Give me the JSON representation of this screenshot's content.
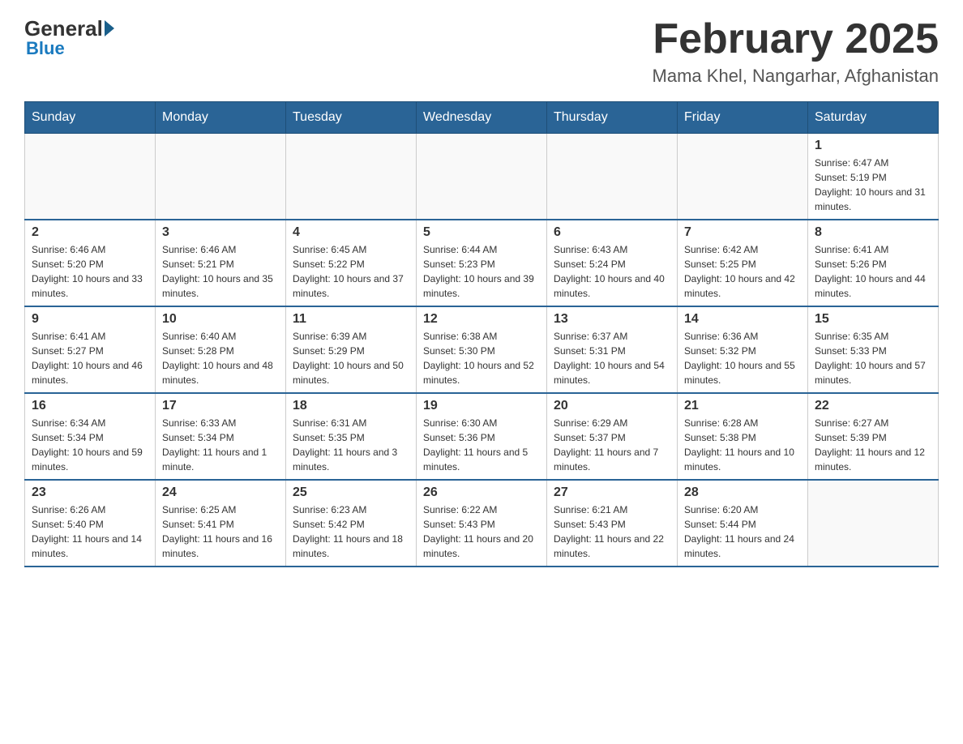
{
  "header": {
    "logo_general": "General",
    "logo_blue": "Blue",
    "month_title": "February 2025",
    "location": "Mama Khel, Nangarhar, Afghanistan"
  },
  "weekdays": [
    "Sunday",
    "Monday",
    "Tuesday",
    "Wednesday",
    "Thursday",
    "Friday",
    "Saturday"
  ],
  "weeks": [
    [
      {
        "day": "",
        "info": ""
      },
      {
        "day": "",
        "info": ""
      },
      {
        "day": "",
        "info": ""
      },
      {
        "day": "",
        "info": ""
      },
      {
        "day": "",
        "info": ""
      },
      {
        "day": "",
        "info": ""
      },
      {
        "day": "1",
        "info": "Sunrise: 6:47 AM\nSunset: 5:19 PM\nDaylight: 10 hours and 31 minutes."
      }
    ],
    [
      {
        "day": "2",
        "info": "Sunrise: 6:46 AM\nSunset: 5:20 PM\nDaylight: 10 hours and 33 minutes."
      },
      {
        "day": "3",
        "info": "Sunrise: 6:46 AM\nSunset: 5:21 PM\nDaylight: 10 hours and 35 minutes."
      },
      {
        "day": "4",
        "info": "Sunrise: 6:45 AM\nSunset: 5:22 PM\nDaylight: 10 hours and 37 minutes."
      },
      {
        "day": "5",
        "info": "Sunrise: 6:44 AM\nSunset: 5:23 PM\nDaylight: 10 hours and 39 minutes."
      },
      {
        "day": "6",
        "info": "Sunrise: 6:43 AM\nSunset: 5:24 PM\nDaylight: 10 hours and 40 minutes."
      },
      {
        "day": "7",
        "info": "Sunrise: 6:42 AM\nSunset: 5:25 PM\nDaylight: 10 hours and 42 minutes."
      },
      {
        "day": "8",
        "info": "Sunrise: 6:41 AM\nSunset: 5:26 PM\nDaylight: 10 hours and 44 minutes."
      }
    ],
    [
      {
        "day": "9",
        "info": "Sunrise: 6:41 AM\nSunset: 5:27 PM\nDaylight: 10 hours and 46 minutes."
      },
      {
        "day": "10",
        "info": "Sunrise: 6:40 AM\nSunset: 5:28 PM\nDaylight: 10 hours and 48 minutes."
      },
      {
        "day": "11",
        "info": "Sunrise: 6:39 AM\nSunset: 5:29 PM\nDaylight: 10 hours and 50 minutes."
      },
      {
        "day": "12",
        "info": "Sunrise: 6:38 AM\nSunset: 5:30 PM\nDaylight: 10 hours and 52 minutes."
      },
      {
        "day": "13",
        "info": "Sunrise: 6:37 AM\nSunset: 5:31 PM\nDaylight: 10 hours and 54 minutes."
      },
      {
        "day": "14",
        "info": "Sunrise: 6:36 AM\nSunset: 5:32 PM\nDaylight: 10 hours and 55 minutes."
      },
      {
        "day": "15",
        "info": "Sunrise: 6:35 AM\nSunset: 5:33 PM\nDaylight: 10 hours and 57 minutes."
      }
    ],
    [
      {
        "day": "16",
        "info": "Sunrise: 6:34 AM\nSunset: 5:34 PM\nDaylight: 10 hours and 59 minutes."
      },
      {
        "day": "17",
        "info": "Sunrise: 6:33 AM\nSunset: 5:34 PM\nDaylight: 11 hours and 1 minute."
      },
      {
        "day": "18",
        "info": "Sunrise: 6:31 AM\nSunset: 5:35 PM\nDaylight: 11 hours and 3 minutes."
      },
      {
        "day": "19",
        "info": "Sunrise: 6:30 AM\nSunset: 5:36 PM\nDaylight: 11 hours and 5 minutes."
      },
      {
        "day": "20",
        "info": "Sunrise: 6:29 AM\nSunset: 5:37 PM\nDaylight: 11 hours and 7 minutes."
      },
      {
        "day": "21",
        "info": "Sunrise: 6:28 AM\nSunset: 5:38 PM\nDaylight: 11 hours and 10 minutes."
      },
      {
        "day": "22",
        "info": "Sunrise: 6:27 AM\nSunset: 5:39 PM\nDaylight: 11 hours and 12 minutes."
      }
    ],
    [
      {
        "day": "23",
        "info": "Sunrise: 6:26 AM\nSunset: 5:40 PM\nDaylight: 11 hours and 14 minutes."
      },
      {
        "day": "24",
        "info": "Sunrise: 6:25 AM\nSunset: 5:41 PM\nDaylight: 11 hours and 16 minutes."
      },
      {
        "day": "25",
        "info": "Sunrise: 6:23 AM\nSunset: 5:42 PM\nDaylight: 11 hours and 18 minutes."
      },
      {
        "day": "26",
        "info": "Sunrise: 6:22 AM\nSunset: 5:43 PM\nDaylight: 11 hours and 20 minutes."
      },
      {
        "day": "27",
        "info": "Sunrise: 6:21 AM\nSunset: 5:43 PM\nDaylight: 11 hours and 22 minutes."
      },
      {
        "day": "28",
        "info": "Sunrise: 6:20 AM\nSunset: 5:44 PM\nDaylight: 11 hours and 24 minutes."
      },
      {
        "day": "",
        "info": ""
      }
    ]
  ]
}
